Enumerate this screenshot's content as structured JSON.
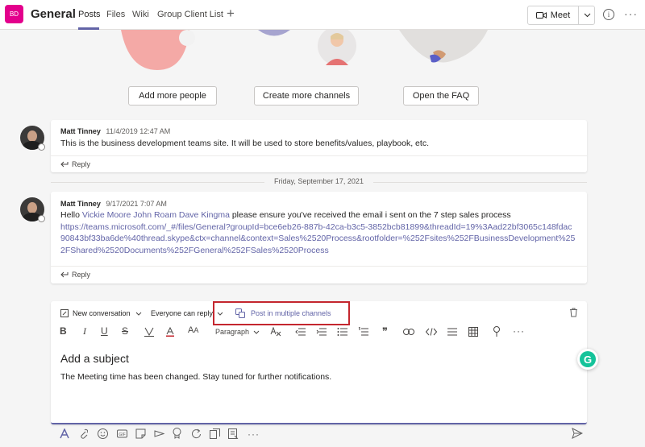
{
  "team": {
    "initials": "BD",
    "color": "#e3008c"
  },
  "channel": {
    "title": "General"
  },
  "tabs": [
    {
      "label": "Posts"
    },
    {
      "label": "Files"
    },
    {
      "label": "Wiki"
    },
    {
      "label": "Group Client List"
    }
  ],
  "header": {
    "meet_label": "Meet",
    "info_glyph": "i",
    "more_glyph": "···",
    "add_glyph": "+"
  },
  "welcome": {
    "buttons": [
      "Add more people",
      "Create more channels",
      "Open the FAQ"
    ]
  },
  "messages": [
    {
      "author": "Matt Tinney",
      "time": "11/4/2019 12:47 AM",
      "text": "This is the business development teams site. It will be used to store benefits/values, playbook, etc.",
      "reply_label": "Reply"
    },
    {
      "author": "Matt Tinney",
      "time": "9/17/2021 7:07 AM",
      "text_prefix": "Hello ",
      "mentions": "Vickie Moore John Roam Dave Kingma",
      "text_suffix": " please ensure you've received the email i sent on the 7 step sales process",
      "link": "https://teams.microsoft.com/_#/files/General?groupId=bce6eb26-887b-42ca-b3c5-3852bcb81899&threadId=19%3Aad22bf3065c148fdac90843bf33ba6de%40thread.skype&ctx=channel&context=Sales%2520Process&rootfolder=%252Fsites%252FBusinessDevelopment%252FShared%2520Documents%252FGeneral%252FSales%2520Process",
      "reply_label": "Reply"
    }
  ],
  "date_divider": "Friday, September 17, 2021",
  "composer": {
    "new_conversation": "New conversation",
    "everyone_can_reply": "Everyone can reply",
    "post_multiple": "Post in multiple channels",
    "paragraph_label": "Paragraph",
    "subject_placeholder": "Add a subject",
    "body_text": "The Meeting time has been changed. Stay tuned for further notifications.",
    "highlight_color": "#c4262e",
    "format_glyphs": {
      "bold": "B",
      "italic": "I",
      "underline": "U",
      "strike": "S",
      "font_size": "A",
      "more": "···",
      "quote": "❞"
    },
    "grammarly_letter": "G"
  },
  "bottom_toolbar": {
    "more_glyph": "···"
  },
  "colors": {
    "accent": "#6264a7",
    "link": "#6264a7",
    "background": "#f5f5f5"
  }
}
